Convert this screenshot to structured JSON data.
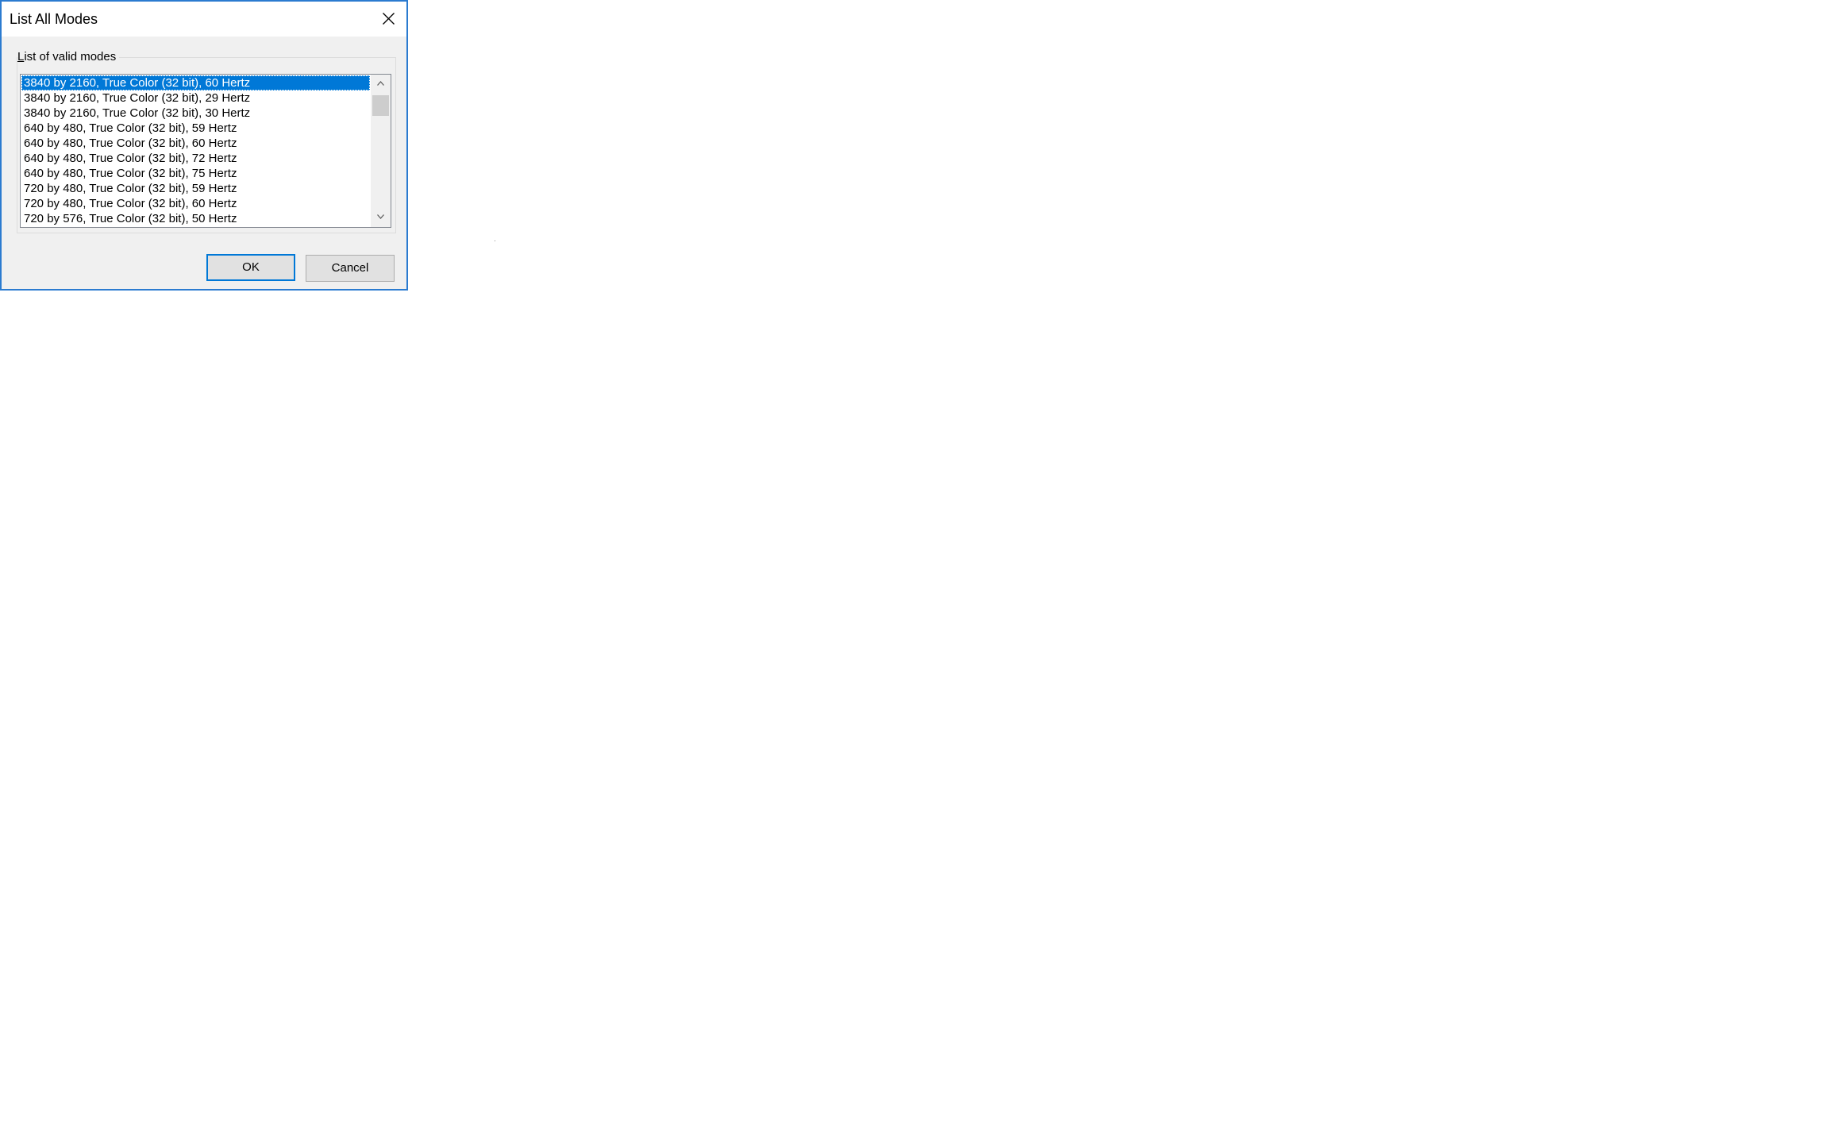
{
  "window": {
    "title": "List All Modes",
    "close_icon": "close-icon"
  },
  "group": {
    "label_access_key": "L",
    "label_rest": "ist of valid modes"
  },
  "modes_list": {
    "selected_index": 0,
    "items": [
      "3840 by 2160, True Color (32 bit), 60 Hertz",
      "3840 by 2160, True Color (32 bit), 29 Hertz",
      "3840 by 2160, True Color (32 bit), 30 Hertz",
      "640 by 480, True Color (32 bit), 59 Hertz",
      "640 by 480, True Color (32 bit), 60 Hertz",
      "640 by 480, True Color (32 bit), 72 Hertz",
      "640 by 480, True Color (32 bit), 75 Hertz",
      "720 by 480, True Color (32 bit), 59 Hertz",
      "720 by 480, True Color (32 bit), 60 Hertz",
      "720 by 576, True Color (32 bit), 50 Hertz"
    ],
    "scroll_up_icon": "chevron-up-icon",
    "scroll_down_icon": "chevron-down-icon"
  },
  "buttons": {
    "ok_label": "OK",
    "cancel_label": "Cancel"
  },
  "colors": {
    "window_border": "#2b7bd0",
    "selection": "#0078d7",
    "dialog_background": "#f0f0f0"
  }
}
